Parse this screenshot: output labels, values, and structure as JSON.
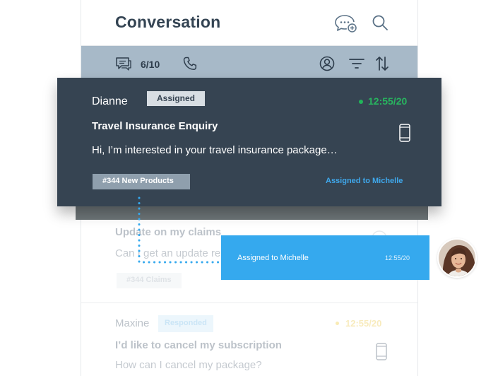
{
  "header": {
    "title": "Conversation"
  },
  "toolbar": {
    "count": "6/10"
  },
  "active_card": {
    "name": "Dianne",
    "badge": "Assigned",
    "time": "12:55/20",
    "title": "Travel Insurance Enquiry",
    "message": "Hi, I’m interested in your travel insurance package…",
    "tag": "#344 New Products",
    "assigned": "Assigned to Michelle"
  },
  "card2": {
    "title": "Update on my claims",
    "message": "Can I get an update re",
    "tag": "#344 Claims"
  },
  "card3": {
    "name": "Maxine",
    "badge": "Responded",
    "time": "12:55/20",
    "title": "I’d like to cancel my subscription",
    "message": "How can I cancel my package?"
  },
  "notification": {
    "text": "Assigned to Michelle",
    "time": "12:55/20"
  },
  "colors": {
    "accent": "#35a9ee",
    "card": "#364452",
    "toolbar": "#a7b9c8",
    "online": "#28b55f",
    "pending": "#f3d35a"
  },
  "icons": [
    "new-chat-icon",
    "search-icon",
    "chat-icon",
    "phone-icon",
    "user-circle-icon",
    "filter-icon",
    "sort-icon",
    "mobile-icon",
    "avatar"
  ]
}
